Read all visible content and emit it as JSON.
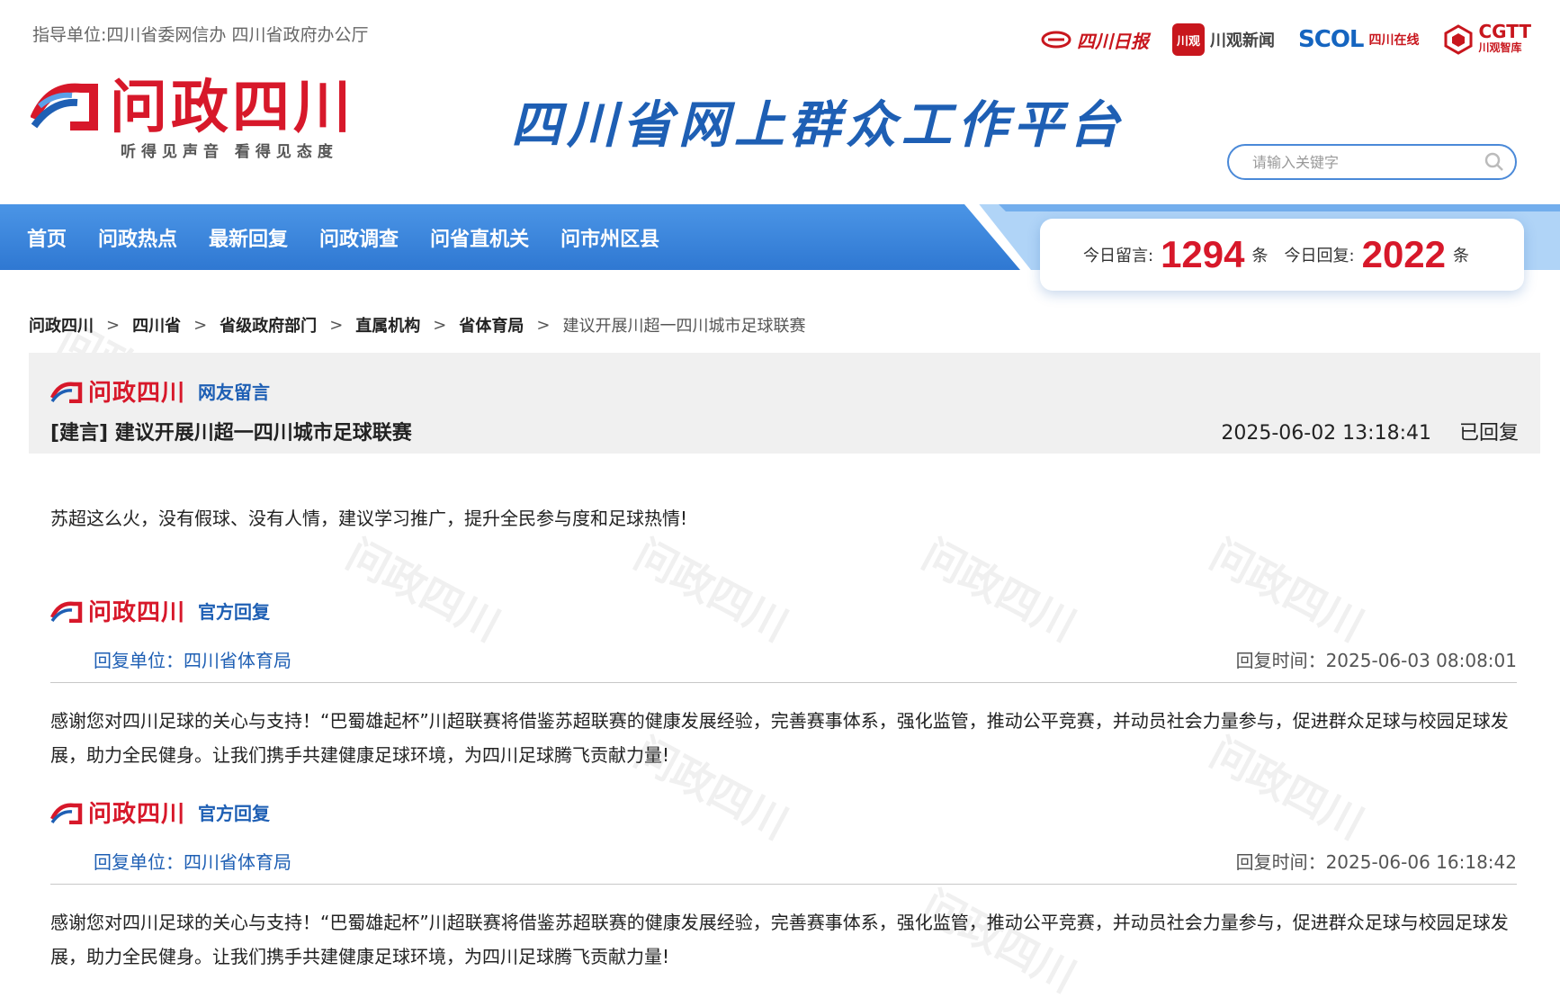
{
  "header": {
    "guide_text": "指导单位:四川省委网信办   四川省政府办公厅",
    "partners": {
      "daily": "四川日报",
      "chuanguan_icon": "川观",
      "chuanguan": "川观新闻",
      "scol": "SCOL",
      "scol_sub": "四川在线",
      "cgtt": "CGTT",
      "cgtt_sub": "川观智库"
    },
    "logo_text": "问政四川",
    "logo_slogan": "听得见声音   看得见态度",
    "platform_title": "四川省网上群众工作平台",
    "search_placeholder": "请输入关键字"
  },
  "nav": {
    "items": [
      "首页",
      "问政热点",
      "最新回复",
      "问政调查",
      "问省直机关",
      "问市州区县"
    ]
  },
  "stats": {
    "today_messages_label": "今日留言:",
    "today_messages": "1294",
    "today_replies_label": "今日回复:",
    "today_replies": "2022",
    "unit": "条"
  },
  "breadcrumb": {
    "items": [
      "问政四川",
      "四川省",
      "省级政府部门",
      "直属机构",
      "省体育局"
    ],
    "current": "建议开展川超一四川城市足球联赛"
  },
  "message": {
    "brand": "问政四川",
    "tag": "网友留言",
    "title": "[建言] 建议开展川超一四川城市足球联赛",
    "datetime": "2025-06-02 13:18:41",
    "status": "已回复",
    "body": "苏超这么火，没有假球、没有人情，建议学习推广，提升全民参与度和足球热情!"
  },
  "replies": [
    {
      "brand": "问政四川",
      "tag": "官方回复",
      "unit": "回复单位：四川省体育局",
      "time": "回复时间：2025-06-03 08:08:01",
      "text": "感谢您对四川足球的关心与支持！“巴蜀雄起杯”川超联赛将借鉴苏超联赛的健康发展经验，完善赛事体系，强化监管，推动公平竞赛，并动员社会力量参与，促进群众足球与校园足球发展，助力全民健身。让我们携手共建健康足球环境，为四川足球腾飞贡献力量!"
    },
    {
      "brand": "问政四川",
      "tag": "官方回复",
      "unit": "回复单位：四川省体育局",
      "time": "回复时间：2025-06-06 16:18:42",
      "text": "感谢您对四川足球的关心与支持！“巴蜀雄起杯”川超联赛将借鉴苏超联赛的健康发展经验，完善赛事体系，强化监管，推动公平竞赛，并动员社会力量参与，促进群众足球与校园足球发展，助力全民健身。让我们携手共建健康足球环境，为四川足球腾飞贡献力量!"
    }
  ],
  "colors": {
    "brand_red": "#d7182a",
    "nav_blue": "#3a86dd",
    "link_blue": "#1e5fb4"
  }
}
